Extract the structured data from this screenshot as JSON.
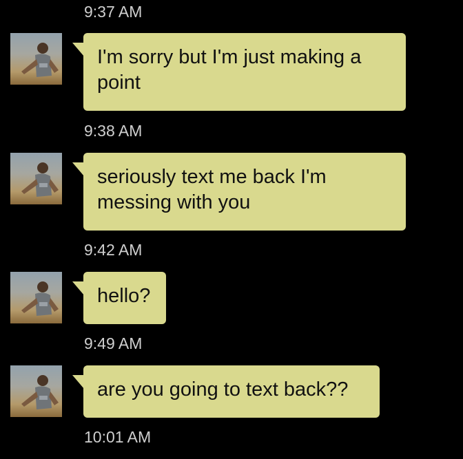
{
  "messages": [
    {
      "time": "9:37 AM",
      "text": "I'm sorry but I'm just making a point"
    },
    {
      "time": "9:38 AM",
      "text": "seriously text me back I'm messing with you"
    },
    {
      "time": "9:42 AM",
      "text": "hello?"
    },
    {
      "time": "9:49 AM",
      "text": "are you going to text back??"
    }
  ],
  "last_timestamp": "10:01 AM",
  "colors": {
    "bubble": "#d9d98e",
    "background": "#000000",
    "timestamp": "#cfcfcf"
  },
  "icons": {
    "avatar": "contact-avatar-photo"
  }
}
